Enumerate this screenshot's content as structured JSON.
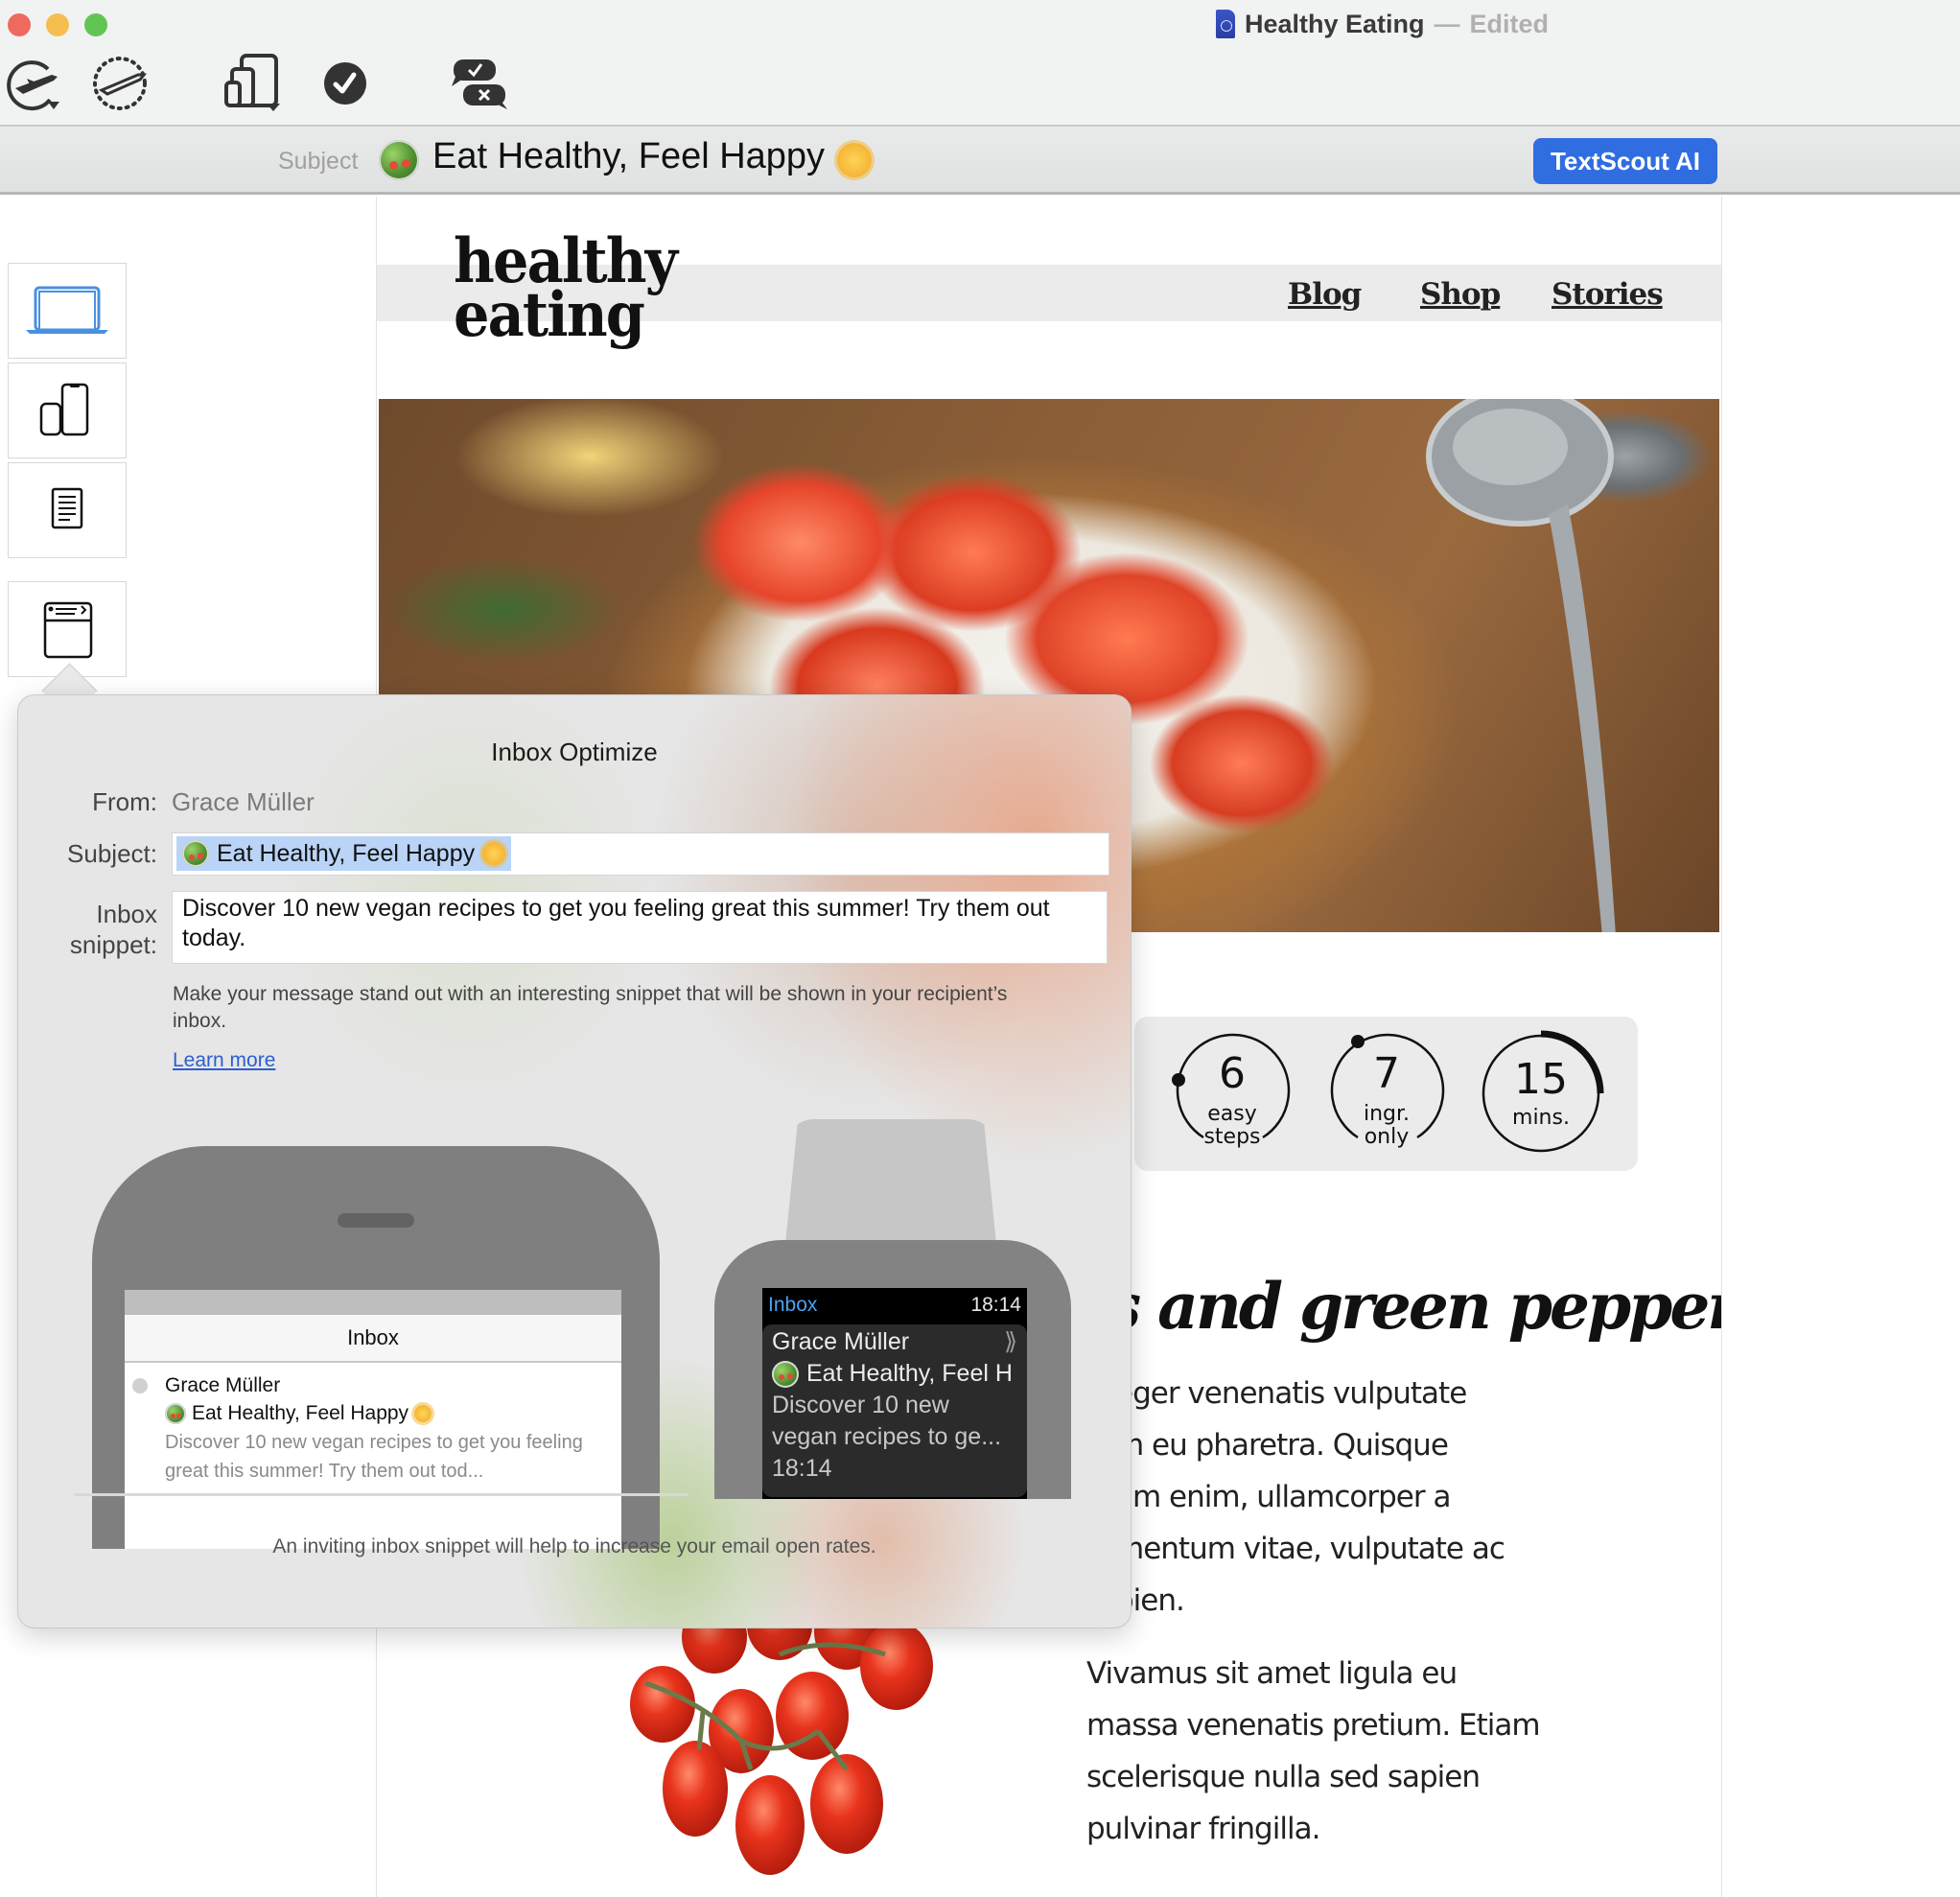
{
  "window": {
    "title": "Healthy Eating",
    "separator": "—",
    "status": "Edited"
  },
  "toolbar": {
    "items": [
      {
        "icon": "send-plane-clock-icon",
        "label": "Send"
      },
      {
        "icon": "scheduled-send-icon",
        "label": "Schedule"
      },
      {
        "icon": "device-preview-icon",
        "label": "Preview devices"
      },
      {
        "icon": "checkmark-circle-icon",
        "label": "Check"
      },
      {
        "icon": "approve-reject-messages-icon",
        "label": "Approval"
      }
    ]
  },
  "subject_bar": {
    "label": "Subject",
    "emoji_before": "salad-emoji",
    "text": "Eat Healthy, Feel Happy",
    "emoji_after": "sun-emoji",
    "ai_button": "TextScout AI",
    "accent": "#2f6de1"
  },
  "sidebar": {
    "items": [
      {
        "name": "desktop-preview",
        "icon": "laptop-icon",
        "active": true
      },
      {
        "name": "mobile-preview",
        "icon": "watch-phone-icon",
        "active": false
      },
      {
        "name": "plain-text-preview",
        "icon": "document-icon",
        "active": false
      },
      {
        "name": "inbox-optimize",
        "icon": "inbox-preview-icon",
        "active": false
      }
    ]
  },
  "email": {
    "logo_line1": "healthy",
    "logo_line2": "eating",
    "nav": [
      "Blog",
      "Shop",
      "Stories"
    ],
    "stats": [
      {
        "number": "6",
        "label_line1": "easy",
        "label_line2": "steps"
      },
      {
        "number": "7",
        "label_line1": "ingr.",
        "label_line2": "only"
      },
      {
        "number": "15",
        "label_line1": "mins.",
        "label_line2": ""
      }
    ],
    "headline_visible": "s and green peppers",
    "paragraph1_visible_lines": [
      "eger venenatis vulputate",
      "m eu pharetra. Quisque",
      "am enim, ullamcorper a",
      "mentum vitae, vulputate ac",
      "pien."
    ],
    "paragraph2_lines": [
      "Vivamus sit amet ligula eu",
      "massa venenatis pretium. Etiam",
      "scelerisque nulla sed sapien",
      "pulvinar fringilla."
    ]
  },
  "popover": {
    "title": "Inbox Optimize",
    "from_label": "From:",
    "from_value": "Grace Müller",
    "subject_label": "Subject:",
    "subject_value": "Eat Healthy, Feel Happy",
    "snippet_label_line1": "Inbox",
    "snippet_label_line2": "snippet:",
    "snippet_value": "Discover 10 new vegan recipes to get you feeling great this summer! Try them out today.",
    "help_text": "Make your message stand out with an interesting snippet that will be shown in your recipient’s inbox.",
    "learn_more": "Learn more",
    "footer": "An inviting inbox snippet will help to increase your email open rates.",
    "phone_preview": {
      "header": "Inbox",
      "from": "Grace Müller",
      "subject": "Eat Healthy, Feel Happy",
      "snippet": "Discover 10 new vegan recipes to get you feeling great this summer! Try them out tod..."
    },
    "watch_preview": {
      "header": "Inbox",
      "time": "18:14",
      "from": "Grace Müller",
      "chevron": "⟫",
      "subject": "Eat Healthy, Feel H",
      "snippet": "Discover 10 new vegan recipes to ge...",
      "timestamp": "18:14"
    }
  }
}
